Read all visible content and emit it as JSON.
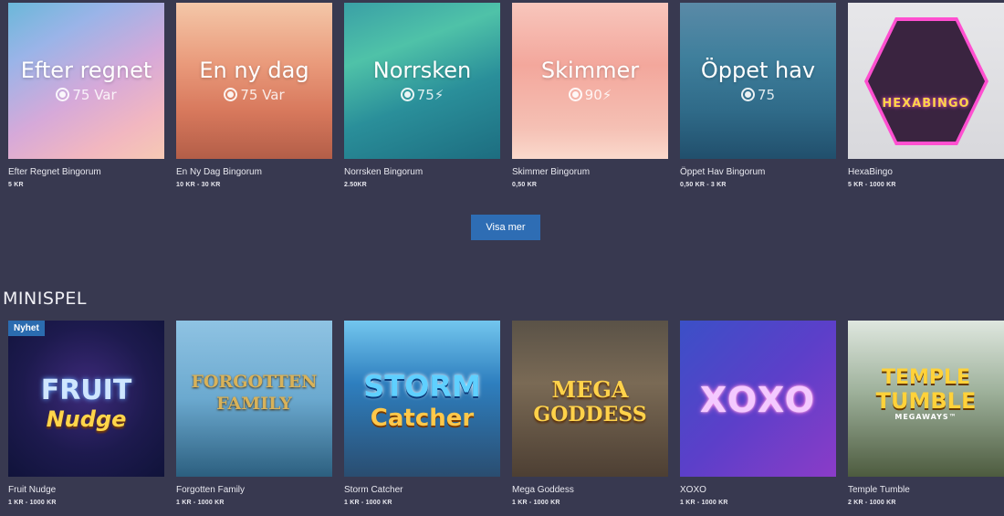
{
  "bingo": [
    {
      "title": "Efter regnet",
      "sub_value": "75",
      "sub_suffix": "Var",
      "name": "Efter Regnet Bingorum",
      "price": "5 KR"
    },
    {
      "title": "En ny dag",
      "sub_value": "75",
      "sub_suffix": "Var",
      "name": "En Ny Dag Bingorum",
      "price": "10 KR - 30 KR"
    },
    {
      "title": "Norrsken",
      "sub_value": "75",
      "sub_suffix": "⚡",
      "name": "Norrsken Bingorum",
      "price": "2.50KR"
    },
    {
      "title": "Skimmer",
      "sub_value": "90",
      "sub_suffix": "⚡",
      "name": "Skimmer Bingorum",
      "price": "0,50 KR"
    },
    {
      "title": "Öppet hav",
      "sub_value": "75",
      "sub_suffix": "",
      "name": "Öppet Hav Bingorum",
      "price": "0,50 KR - 3 KR"
    },
    {
      "title": "HEXABINGO",
      "name": "HexaBingo",
      "price": "5 KR - 1000 KR"
    }
  ],
  "show_more_label": "Visa mer",
  "section_title": "MINISPEL",
  "badge": "Nyhet",
  "minigames": [
    {
      "logo_line1": "FRUIT",
      "logo_line2": "Nudge",
      "name": "Fruit Nudge",
      "price": "1 KR - 1000 KR"
    },
    {
      "logo_line1": "FORGOTTEN",
      "logo_line2": "FAMILY",
      "name": "Forgotten Family",
      "price": "1 KR - 1000 KR"
    },
    {
      "logo_line1": "STORM",
      "logo_line2": "Catcher",
      "name": "Storm Catcher",
      "price": "1 KR - 1000 KR"
    },
    {
      "logo_line1": "MEGA",
      "logo_line2": "GODDESS",
      "name": "Mega Goddess",
      "price": "1 KR - 1000 KR"
    },
    {
      "logo_line1": "XOXO",
      "logo_line2": "",
      "name": "XOXO",
      "price": "1 KR - 1000 KR"
    },
    {
      "logo_line1": "TEMPLE",
      "logo_line2": "TUMBLE",
      "logo_line3": "MEGAWAYS™",
      "name": "Temple Tumble",
      "price": "2 KR - 1000 KR"
    }
  ]
}
